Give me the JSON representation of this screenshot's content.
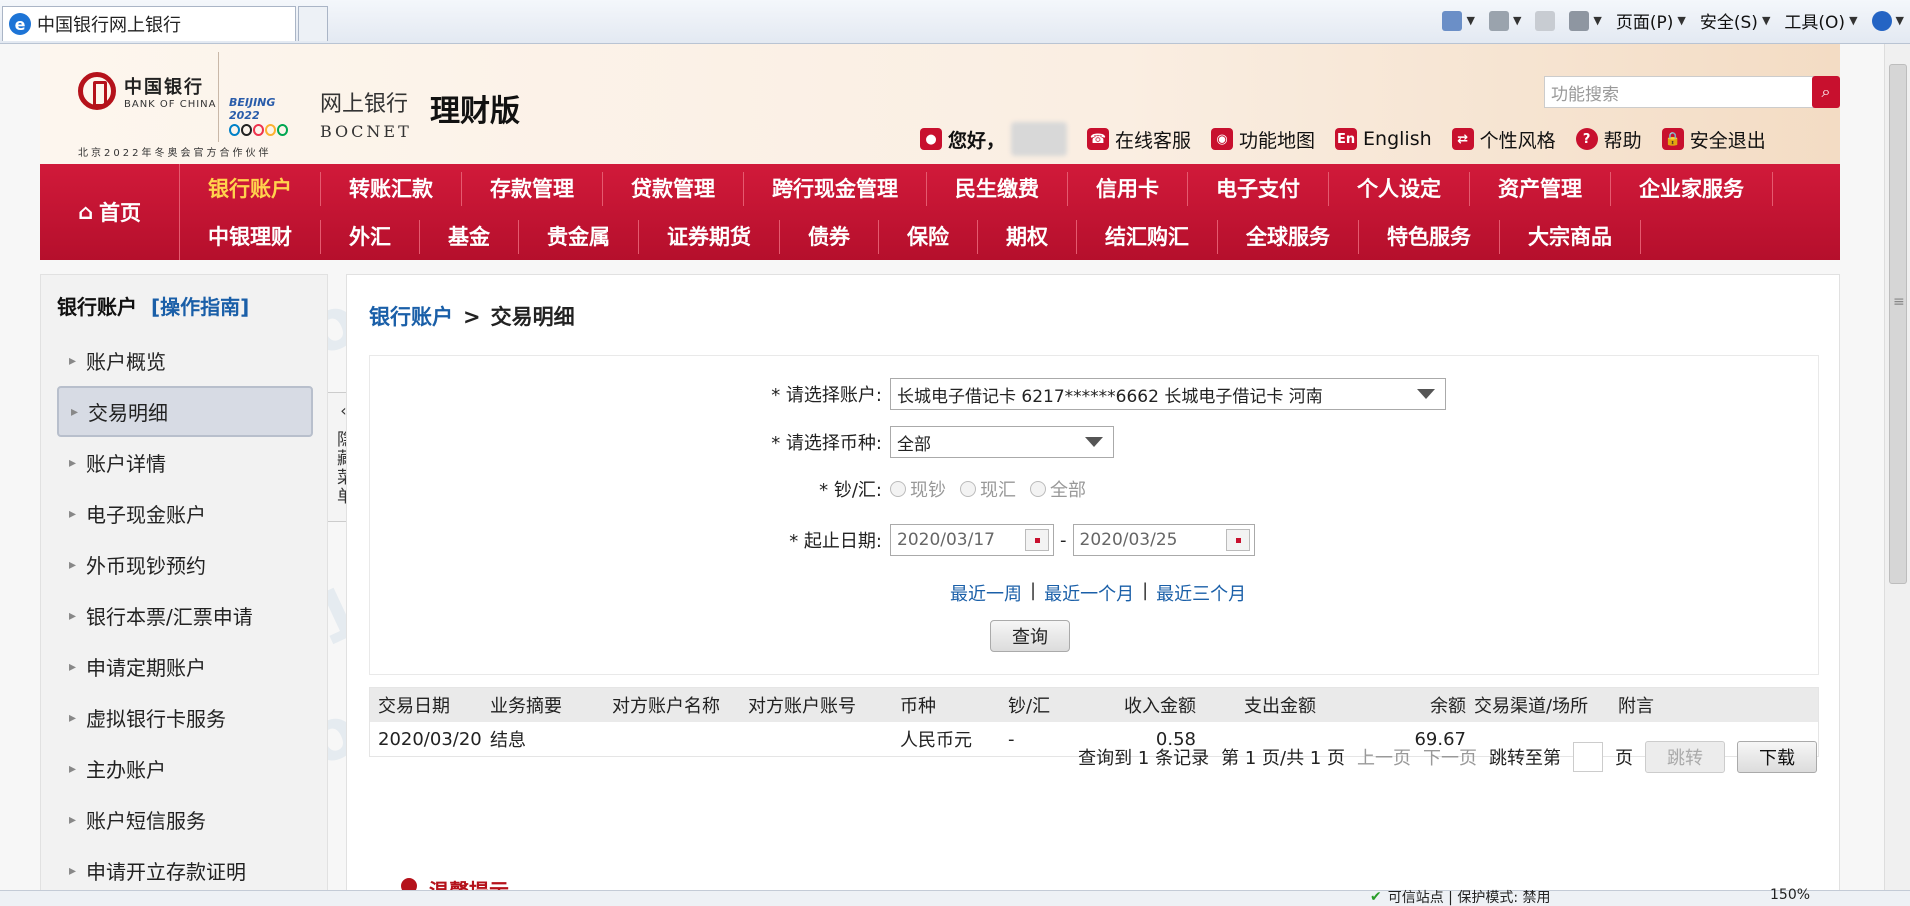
{
  "browser": {
    "tab_title": "中国银行网上银行",
    "menu": {
      "page": "页面(P)",
      "safety": "安全(S)",
      "tools": "工具(O)"
    }
  },
  "header": {
    "logo_cn": "中国银行",
    "logo_en": "BANK OF CHINA",
    "olympic_text": "BEIJING 2022",
    "partner_text": "北京2022年冬奥会官方合作伙伴",
    "netbank_cn": "网上银行",
    "netbank_en": "BOCNET",
    "edition": "理财版",
    "search_placeholder": "功能搜索",
    "greeting": "您好，",
    "links": {
      "online_service": "在线客服",
      "function_map": "功能地图",
      "english": "English",
      "style": "个性风格",
      "help": "帮助",
      "logout": "安全退出"
    }
  },
  "nav": {
    "home": "首页",
    "row1": [
      "银行账户",
      "转账汇款",
      "存款管理",
      "贷款管理",
      "跨行现金管理",
      "民生缴费",
      "信用卡",
      "电子支付",
      "个人设定",
      "资产管理",
      "企业家服务"
    ],
    "row2": [
      "中银理财",
      "外汇",
      "基金",
      "贵金属",
      "证券期货",
      "债券",
      "保险",
      "期权",
      "结汇购汇",
      "全球服务",
      "特色服务",
      "大宗商品"
    ]
  },
  "sidebar": {
    "title": "银行账户",
    "guide": "[操作指南]",
    "items": [
      "账户概览",
      "交易明细",
      "账户详情",
      "电子现金账户",
      "外币现钞预约",
      "银行本票/汇票申请",
      "申请定期账户",
      "虚拟银行卡服务",
      "主办账户",
      "账户短信服务",
      "申请开立存款证明"
    ],
    "hide_label": "隐藏菜单"
  },
  "main": {
    "crumb_link": "银行账户",
    "crumb_sep": ">",
    "crumb_current": "交易明细",
    "form": {
      "account_label": "* 请选择账户:",
      "account_value": "长城电子借记卡  6217******6662  长城电子借记卡   河南",
      "currency_label": "* 请选择币种:",
      "currency_value": "全部",
      "cash_label": "* 钞/汇:",
      "cash_options": [
        "现钞",
        "现汇",
        "全部"
      ],
      "date_label": "* 起止日期:",
      "date_from": "2020/03/17",
      "date_sep": "-",
      "date_to": "2020/03/25",
      "quick": [
        "最近一周",
        "最近一个月",
        "最近三个月"
      ],
      "query_btn": "查询"
    },
    "table": {
      "headers": [
        "交易日期",
        "业务摘要",
        "对方账户名称",
        "对方账户账号",
        "币种",
        "钞/汇",
        "收入金额",
        "支出金额",
        "余额",
        "交易渠道/场所",
        "附言"
      ],
      "rows": [
        [
          "2020/03/20",
          "结息",
          "",
          "",
          "人民币元",
          "-",
          "0.58",
          "",
          "69.67",
          "",
          ""
        ]
      ]
    },
    "pager": {
      "found_prefix": "查询到",
      "found_count": "1",
      "found_suffix": "条记录",
      "page_prefix": "第",
      "page_cur": "1",
      "page_mid": "页/共",
      "page_total": "1",
      "page_suffix": "页",
      "prev": "上一页",
      "next": "下一页",
      "goto_label": "跳转至第",
      "goto_suffix": "页",
      "goto_btn": "跳转",
      "download_btn": "下载"
    },
    "tip_title": "温馨提示"
  },
  "statusbar": {
    "trusted": "可信站点 | 保护模式: 禁用",
    "zoom": "150%"
  }
}
